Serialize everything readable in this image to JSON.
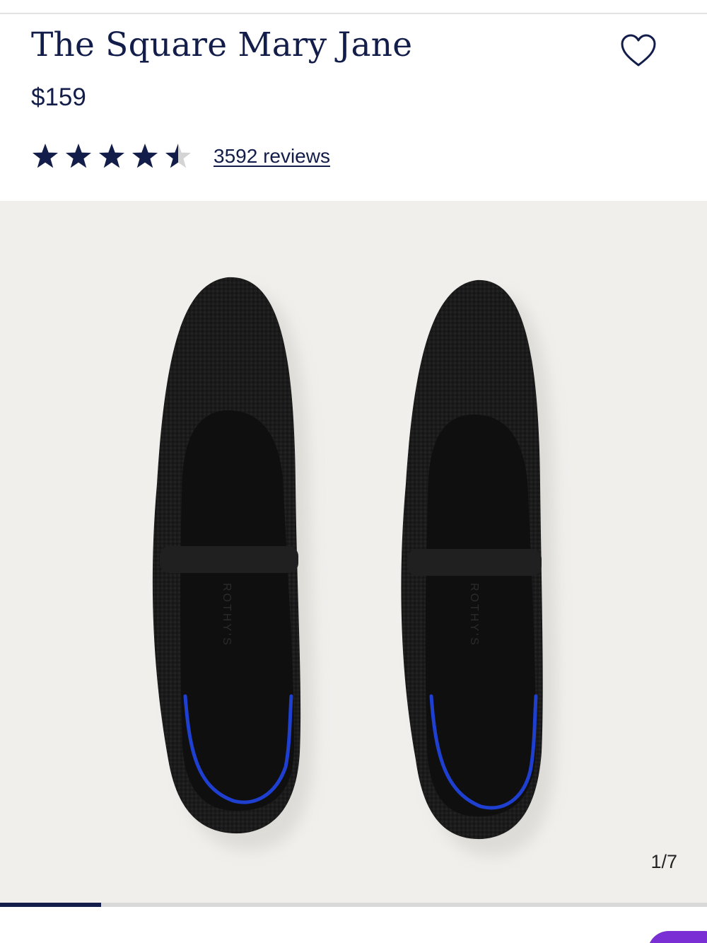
{
  "product": {
    "title": "The Square Mary Jane",
    "price": "$159"
  },
  "rating": {
    "value": 4.5,
    "max": 5,
    "reviews_label": "3592 reviews"
  },
  "gallery": {
    "counter": "1/7",
    "progress": 0.143,
    "insole_brand": "ROTHY'S"
  },
  "colors": {
    "brand_navy": "#131d4a",
    "gallery_bg": "#f0efec",
    "shoe_knit": "#1b1b1b",
    "accent_blue": "#1f3fd1",
    "chat_purple": "#7a2fd4"
  },
  "icons": {
    "wishlist": "heart-outline-icon",
    "star": "star-icon",
    "chat": "chat-bubble"
  }
}
